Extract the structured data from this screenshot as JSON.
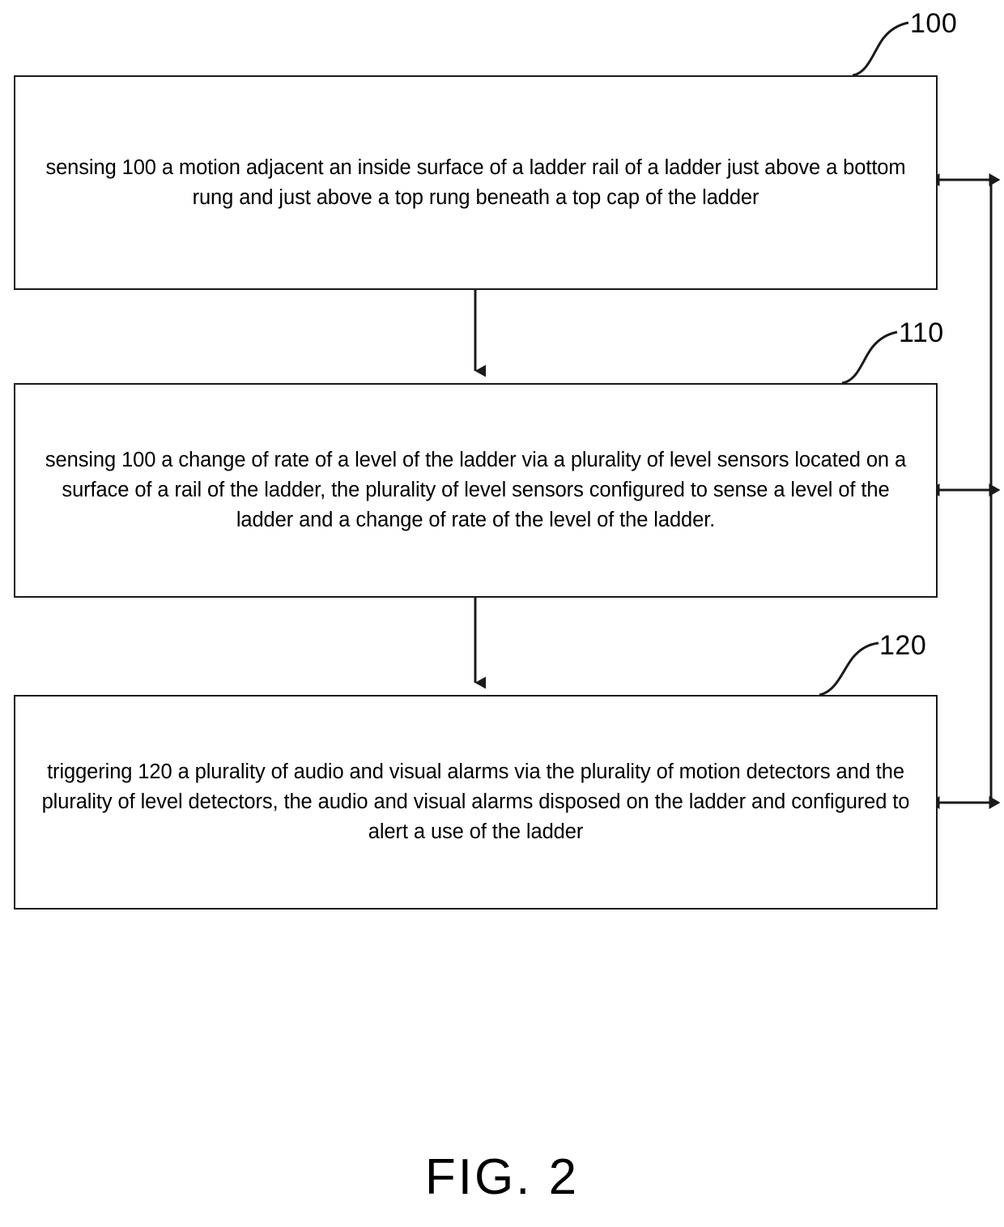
{
  "figure": {
    "caption": "FIG. 2",
    "title": "Method flowchart for ladder motion and level sensing with alarm triggering"
  },
  "diagram": {
    "type": "flowchart",
    "orientation": "vertical",
    "line_color": "#1a1a1a",
    "background_color": "#ffffff",
    "steps": [
      {
        "ref": "100",
        "name": "sensing-motion-step",
        "text": "sensing 100 a motion adjacent an inside surface of a ladder rail of a ladder just above a bottom rung and just above a top rung beneath a top cap of the ladder"
      },
      {
        "ref": "110",
        "name": "sensing-level-change-step",
        "text": "sensing 100 a change of rate of a level of the ladder via a plurality of level sensors located on a surface of a rail of the ladder, the plurality of level sensors configured to sense a level of the ladder and a change of rate of the level of the ladder."
      },
      {
        "ref": "120",
        "name": "triggering-alarms-step",
        "text": "triggering 120 a plurality of audio and visual alarms via the plurality  of motion detectors and the plurality of level detectors, the audio and visual alarms disposed on the ladder and configured to alert a use of the ladder"
      }
    ],
    "connectors": [
      {
        "name": "flow-arrow-100-to-110",
        "from_ref": "100",
        "to_ref": "110",
        "style": "single-headed-down"
      },
      {
        "name": "flow-arrow-110-to-120",
        "from_ref": "110",
        "to_ref": "120",
        "style": "single-headed-down"
      }
    ],
    "side_bus": {
      "name": "bidirectional-side-bus",
      "description": "vertical line at right joined to each step box by a double-headed arrow",
      "arrows": [
        {
          "name": "bus-arrow-step-100",
          "ref": "100",
          "style": "double-headed-horizontal"
        },
        {
          "name": "bus-arrow-step-110",
          "ref": "110",
          "style": "double-headed-horizontal"
        },
        {
          "name": "bus-arrow-step-120",
          "ref": "120",
          "style": "double-headed-horizontal"
        }
      ]
    }
  }
}
